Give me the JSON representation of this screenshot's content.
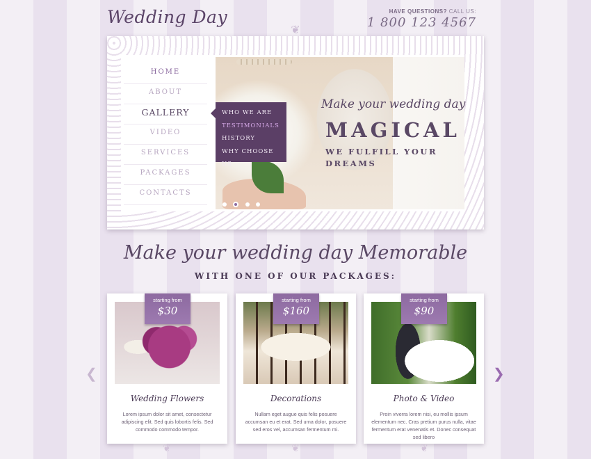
{
  "header": {
    "logo": "Wedding Day",
    "contact_label": "HAVE QUESTIONS?",
    "contact_label_suffix": "CALL US:",
    "phone": "1 800 123 4567"
  },
  "nav": {
    "items": [
      {
        "label": "HOME"
      },
      {
        "label": "ABOUT"
      },
      {
        "label": "GALLERY"
      },
      {
        "label": "VIDEO"
      },
      {
        "label": "SERVICES"
      },
      {
        "label": "PACKAGES"
      },
      {
        "label": "CONTACTS"
      }
    ],
    "submenu": [
      {
        "label": "WHO WE ARE"
      },
      {
        "label": "TESTIMONIALS"
      },
      {
        "label": "HISTORY"
      },
      {
        "label": "WHY CHOOSE US"
      }
    ]
  },
  "slider": {
    "script": "Make your wedding day",
    "headline": "MAGICAL",
    "subline": "WE FULFILL YOUR DREAMS",
    "dots": 4,
    "active_dot": 2
  },
  "packages": {
    "title": "Make your wedding day Memorable",
    "subtitle": "WITH ONE OF OUR PACKAGES:",
    "cards": [
      {
        "badge_label": "starting from",
        "price": "$30",
        "title": "Wedding Flowers",
        "text": "Lorem ipsum dolor sit amet, consectetur adipiscing elit. Sed quis lobortis felis.  Sed commodo commodo tempor."
      },
      {
        "badge_label": "starting from",
        "price": "$160",
        "title": "Decorations",
        "text": "Nullam eget augue quis felis posuere accumsan eu et erat. Sed urna dolor, posuere sed eros vel, accumsan fermentum mi."
      },
      {
        "badge_label": "starting from",
        "price": "$90",
        "title": "Photo & Video",
        "text": "Proin viverra lorem nisi, eu mollis ipsum elementum nec. Cras pretium purus nulla, vitae fermentum erat venenatis et. Donec consequat sed libero"
      }
    ]
  },
  "colors": {
    "accent": "#8c6ba0",
    "submenu_bg": "#5b3f66",
    "text": "#5a4865"
  }
}
